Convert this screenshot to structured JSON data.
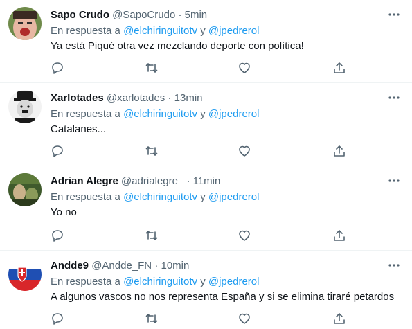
{
  "tweets": [
    {
      "name": "Sapo Crudo",
      "handle": "@SapoCrudo",
      "time": "5min",
      "reply_prefix": "En respuesta a",
      "mention1": "@elchiringuitotv",
      "conj": "y",
      "mention2": "@jpedrerol",
      "text": "Ya está Piqué otra vez mezclando deporte con política!"
    },
    {
      "name": "Xarlotades",
      "handle": "@xarlotades",
      "time": "13min",
      "reply_prefix": "En respuesta a",
      "mention1": "@elchiringuitotv",
      "conj": "y",
      "mention2": "@jpedrerol",
      "text": "Catalanes..."
    },
    {
      "name": "Adrian Alegre",
      "handle": "@adrialegre_",
      "time": "11min",
      "reply_prefix": "En respuesta a",
      "mention1": "@elchiringuitotv",
      "conj": "y",
      "mention2": "@jpedrerol",
      "text": "Yo no"
    },
    {
      "name": "Andde9",
      "handle": "@Andde_FN",
      "time": "10min",
      "reply_prefix": "En respuesta a",
      "mention1": "@elchiringuitotv",
      "conj": "y",
      "mention2": "@jpedrerol",
      "text": "A algunos vascos no nos representa España y si se elimina tiraré petardos"
    }
  ],
  "separator": "·",
  "icons": {
    "reply": "reply-icon",
    "retweet": "retweet-icon",
    "like": "heart-icon",
    "share": "share-icon",
    "more": "more-options-icon"
  },
  "colors": {
    "link": "#1d9bf0",
    "secondary": "#536471",
    "text": "#0f1419",
    "divider": "#eff3f4"
  }
}
